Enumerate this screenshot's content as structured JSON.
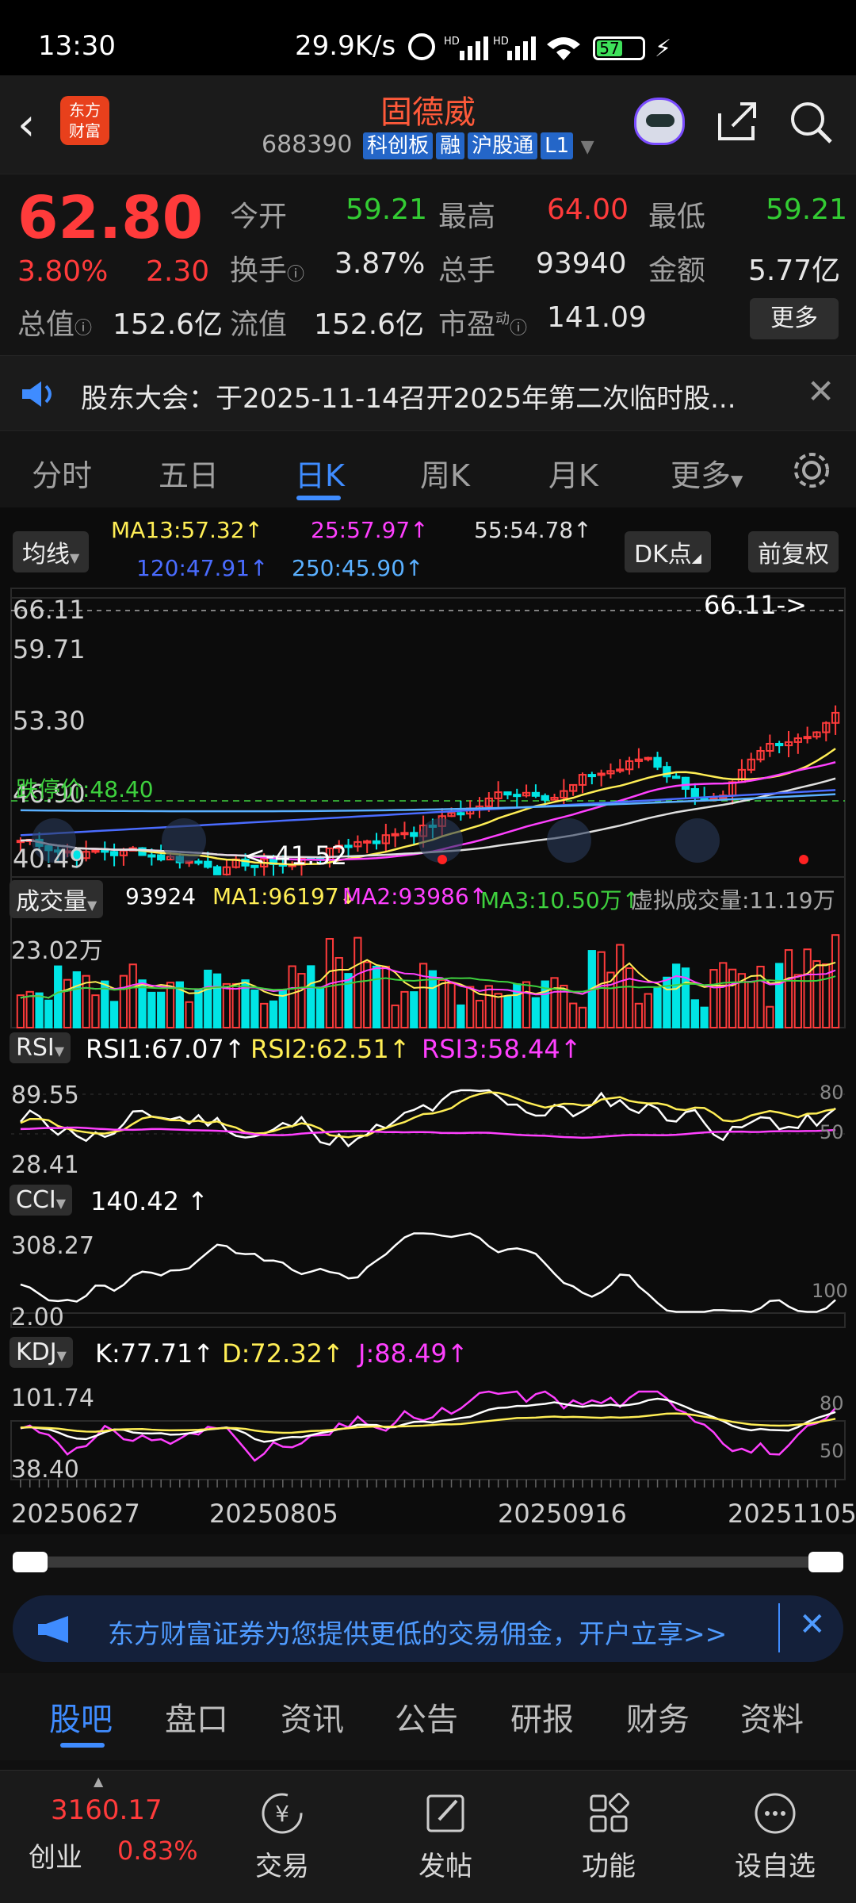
{
  "status": {
    "time": "13:30",
    "speed": "29.9K/s",
    "battery": "57"
  },
  "header": {
    "logo_line1": "东方",
    "logo_line2": "财富",
    "title": "固德威",
    "code": "688390",
    "tags": [
      "科创板",
      "融",
      "沪股通",
      "L1"
    ]
  },
  "quote": {
    "price": "62.80",
    "change_pct": "3.80%",
    "change": "2.30",
    "open_label": "今开",
    "open": "59.21",
    "high_label": "最高",
    "high": "64.00",
    "low_label": "最低",
    "low": "59.21",
    "turnover_label": "换手",
    "turnover": "3.87%",
    "vol_label": "总手",
    "vol": "93940",
    "amount_label": "金额",
    "amount": "5.77亿",
    "mktcap_label": "总值",
    "mktcap": "152.6亿",
    "float_label": "流值",
    "float": "152.6亿",
    "pe_label": "市盈",
    "pe_sup": "动",
    "pe": "141.09",
    "more": "更多"
  },
  "notice": {
    "text": "股东大会：于2025-11-14召开2025年第二次临时股..."
  },
  "tabs": [
    "分时",
    "五日",
    "日K",
    "周K",
    "月K",
    "更多"
  ],
  "chart": {
    "ma_btn": "均线",
    "dk_btn": "DK点",
    "fq_btn": "前复权",
    "ma13": "MA13:57.32",
    "ma25": "25:57.97",
    "ma55": "55:54.78",
    "ma120": "120:47.91",
    "ma250": "250:45.90",
    "y_top": "66.11",
    "y2": "59.71",
    "y3": "53.30",
    "y4": "46.90",
    "y5": "40.49",
    "max_label": "66.11->",
    "min_label": "<-41.52",
    "limit_label": "跌停价:48.40",
    "vol_btn": "成交量",
    "vol_val": "93924",
    "vma1": "MA1:96197",
    "vma2": "MA2:93986",
    "vma3": "MA3:10.50万",
    "vvirt": "虚拟成交量:11.19万",
    "vol_max": "23.02万",
    "rsi_btn": "RSI",
    "rsi1": "RSI1:67.07",
    "rsi2": "RSI2:62.51",
    "rsi3": "RSI3:58.44",
    "rsi_hi": "89.55",
    "rsi_lo": "28.41",
    "rsi_80": "80",
    "rsi_50": "50",
    "cci_btn": "CCI",
    "cci_val": "140.42",
    "cci_hi": "308.27",
    "cci_lo": "2.00",
    "cci_100": "100",
    "kdj_btn": "KDJ",
    "k": "K:77.71",
    "d": "D:72.32",
    "j": "J:88.49",
    "kdj_hi": "101.74",
    "kdj_lo": "38.40",
    "kdj_80": "80",
    "kdj_50": "50",
    "dates": [
      "20250627",
      "20250805",
      "20250916",
      "20251105"
    ]
  },
  "ad": {
    "text": "东方财富证券为您提供更低的交易佣金，开户立享>>"
  },
  "bottom_tabs": [
    "股吧",
    "盘口",
    "资讯",
    "公告",
    "研报",
    "财务",
    "资料"
  ],
  "footer": {
    "index_val": "3160.17",
    "index_name": "创业",
    "index_pct": "0.83%",
    "items": [
      "交易",
      "发帖",
      "功能",
      "设自选"
    ]
  },
  "colors": {
    "up": "#ff3b3b",
    "down": "#00e5e5",
    "accent": "#3f8cff",
    "ma13": "#ffee55",
    "ma25": "#ff40ff",
    "ma55": "#e0e0e0",
    "ma120": "#4a6cff",
    "ma250": "#5ab0ff"
  }
}
